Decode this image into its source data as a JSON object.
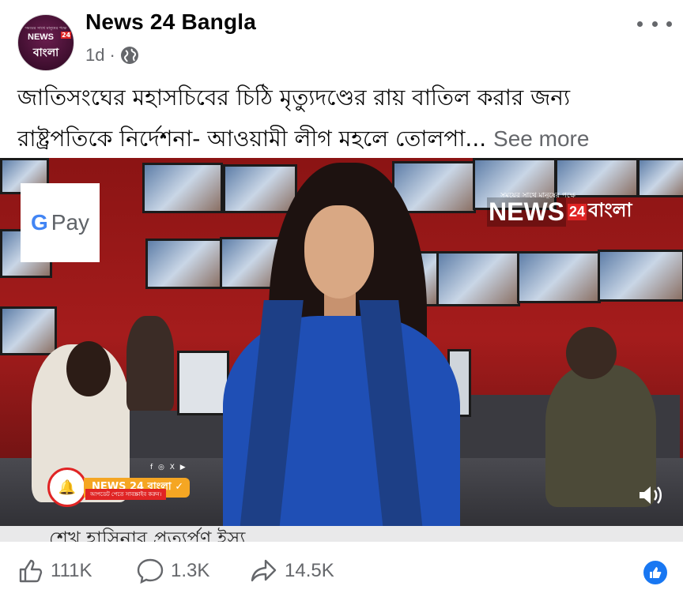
{
  "post": {
    "page_name": "News 24 Bangla",
    "time": "1d",
    "separator": "·",
    "privacy_icon": "globe-icon",
    "more_icon": "three-dots-icon",
    "avatar": {
      "tiny_text": "সময়ের সাথে মানুষের পক্ষে",
      "news": "NEWS",
      "num": "24",
      "bangla": "বাংলা"
    },
    "caption_line1": "জাতিসংঘের মহাসচিবের চিঠি মৃত্যুদণ্ডের রায় বাতিল করার জন্য",
    "caption_line2": "রাষ্ট্রপতিকে নির্দেশনা- আওয়ামী লীগ মহলে তোলপা...",
    "see_more": "See more"
  },
  "video": {
    "gpay_g": "G",
    "gpay_text": "Pay",
    "brand_top": "সময়ের সাথে মানুষের পক্ষে",
    "brand_news": "NEWS",
    "brand_num": "24",
    "brand_bangla": "বাংলা",
    "lower_bar": "NEWS 24 বাংলা ✓",
    "lower_sub": "আপডেট পেতে সাবস্ক্রাইব করুন।",
    "social": "f ◎ X ▶",
    "ticker": "শেখ হাসিনার প্রত্যর্পণ ইস্যু",
    "volume_icon": "speaker-icon"
  },
  "actions": {
    "likes": "111K",
    "comments": "1.3K",
    "shares": "14.5K",
    "accent": "#1877f2"
  }
}
